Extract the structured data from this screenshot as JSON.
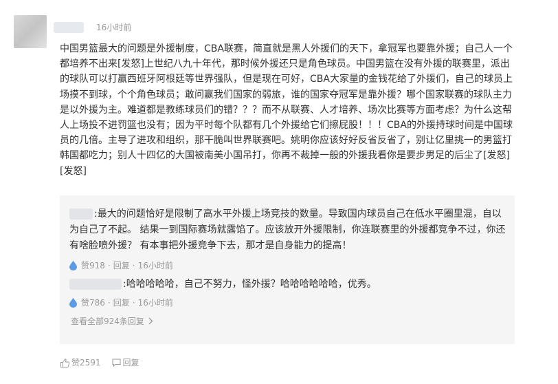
{
  "comment": {
    "time": "16小时前",
    "text": "中国男篮最大的问题是外援制度，CBA联赛，简直就是黑人外援们的天下，拿冠军也要靠外援；自己人一个都培养不出来[发怒]上世纪八九十年代，那时候外援还只是角色球员。中国男篮在没有外援的联赛里，派出的球队可以打赢西班牙阿根廷等世界强队，但是现在可好，CBA大家量的金钱花给了外援们，自己的球员上场摸不到球，个个角色球员；敢问赢我们国家的弱旅，谁的国家夺冠军是靠外援？哪个国家联赛的球队主力是以外援为主。难道都是教练球员们的错？？？而不从联赛、人才培养、场次比赛等方面考虑？为什么这帮人上场投不进罚篮也没有；因为平时每个队都有几个外援给它们擦屁股！！！CBA的外援持球时间是中国球员的几倍。主导了进攻和组织，那干脆叫世界联赛吧。姚明你应该好好反省反省了，别让亿里挑一的男篮打韩国都吃力；别人十四亿的大国被南美小国吊打，你再不裁掉一般的外援我看你是要步男足的后尘了[发怒][发怒]",
    "likes_label": "赞2591",
    "reply_label": "回复"
  },
  "replies": [
    {
      "text": ":最大的问题恰好是限制了高水平外援上场竞技的数量。导致国内球员自己在低水平圈里混，自以为自己了不起。 结果一到国际赛场就露馅了。应该放开外援限制，你连联赛里的外援都竞争不过，你还有啥脸喷外援？ 有本事把外援竞争下去，那才是自身能力的提高！",
      "likes_label": "赞918",
      "reply_label": "回复",
      "time": "16小时前"
    },
    {
      "text": ":哈哈哈哈哈，自己不努力，怪外援？哈哈哈哈哈哈，优秀。",
      "likes_label": "赞786",
      "reply_label": "回复",
      "time": "16小时前"
    }
  ],
  "view_all_label": "查看全部924条回复",
  "colors": {
    "like_blue": "#5a9be6",
    "meta_gray": "#999999",
    "reply_bg": "#f5f5f5"
  },
  "icons": {
    "like": "water-drop-like-icon",
    "thumb": "thumbs-up-icon",
    "reply": "chat-bubble-icon",
    "chevron": "chevron-right-icon"
  }
}
